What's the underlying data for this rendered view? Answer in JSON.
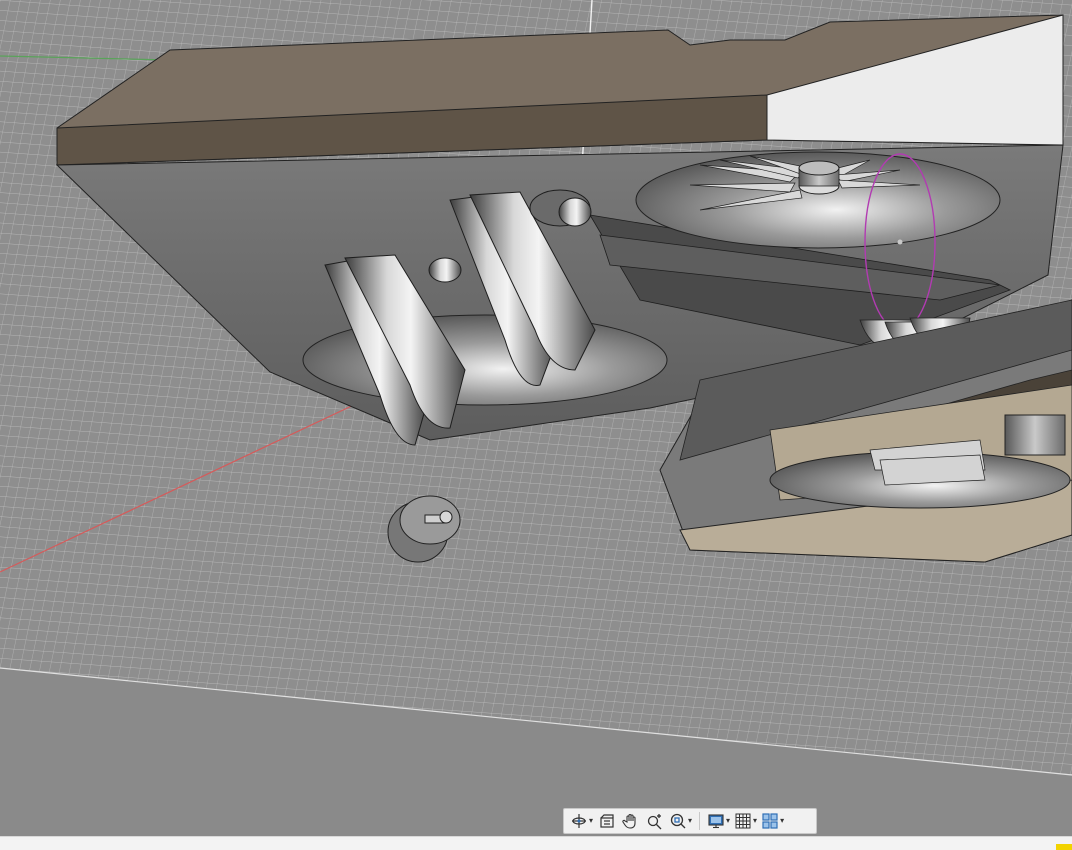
{
  "viewport": {
    "scene": "cad-3d-model",
    "background_color": "#8a8a8a",
    "grid_color": "#b7b7b7",
    "x_axis_color": "#d65a5a",
    "y_axis_color": "#5aa35a",
    "selection_outline_color": "#b23bb2",
    "body_top_color": "#7d7062",
    "body_side_color": "#6d6d6d",
    "panel_color": "#ececec",
    "tan_surface_color": "#b9ad98"
  },
  "nav_toolbar": {
    "tools": [
      {
        "icon": "orbit-icon",
        "has_dropdown": true
      },
      {
        "icon": "look-at-icon",
        "has_dropdown": false
      },
      {
        "icon": "pan-hand-icon",
        "has_dropdown": false
      },
      {
        "icon": "zoom-icon",
        "has_dropdown": false
      },
      {
        "icon": "fit-zoom-icon",
        "has_dropdown": true
      },
      {
        "icon": "display-settings-icon",
        "has_dropdown": true
      },
      {
        "icon": "grid-settings-icon",
        "has_dropdown": true
      },
      {
        "icon": "viewports-icon",
        "has_dropdown": true
      }
    ],
    "accent_color": "#2f6fb5"
  },
  "status_strip": {
    "accent_color": "#f2d300"
  }
}
